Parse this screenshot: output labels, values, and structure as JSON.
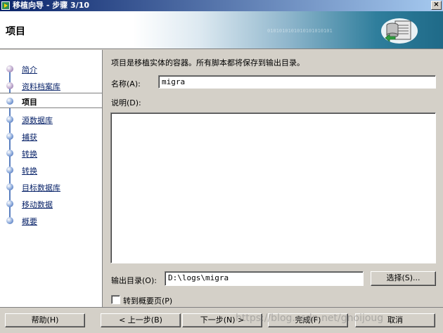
{
  "window": {
    "title": "移植向导 - 步骤 3/10",
    "close_glyph": "×"
  },
  "header": {
    "title": "项目",
    "binary_text": "0101010101010101010101"
  },
  "nav": {
    "items": [
      {
        "label": "简介",
        "state": "done"
      },
      {
        "label": "资料档案库",
        "state": "done"
      },
      {
        "label": "项目",
        "state": "active"
      },
      {
        "label": "源数据库",
        "state": "pending"
      },
      {
        "label": "捕获",
        "state": "pending"
      },
      {
        "label": "转换",
        "state": "pending"
      },
      {
        "label": "转换",
        "state": "pending"
      },
      {
        "label": "目标数据库",
        "state": "pending"
      },
      {
        "label": "移动数据",
        "state": "pending"
      },
      {
        "label": "概要",
        "state": "pending"
      }
    ]
  },
  "form": {
    "description": "项目是移植实体的容器。所有脚本都将保存到输出目录。",
    "name_label": "名称(A):",
    "name_value": "migra",
    "notes_label": "说明(D):",
    "output_label": "输出目录(O):",
    "output_value": "D:\\logs\\migra",
    "choose_button": "选择(S)...",
    "goto_summary_label": "转到概要页(P)"
  },
  "footer": {
    "help": "帮助(H)",
    "back": "< 上一步(B)",
    "next": "下一步(N) >",
    "finish": "完成(F)",
    "cancel": "取消",
    "watermark": "https://blog.csdn.net/gnoijoug"
  }
}
